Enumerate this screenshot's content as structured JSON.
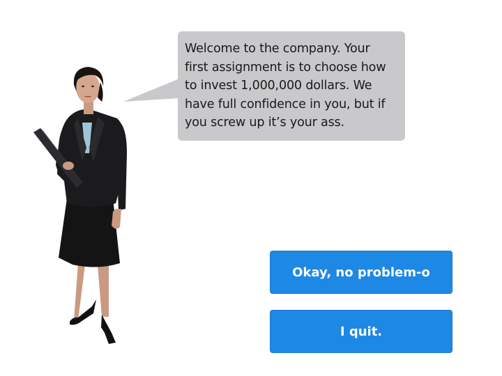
{
  "dialog": {
    "speech": "Welcome to the company. Your\nfirst assignment is to choose how\nto invest 1,000,000 dollars. We\nhave full confidence in you, but if\nyou screw up it’s your ass."
  },
  "choices": [
    {
      "label": "Okay, no problem-o"
    },
    {
      "label": "I quit."
    }
  ],
  "colors": {
    "button": "#1e88e5",
    "bubble": "#c9c9cc"
  },
  "icons": {
    "character": "businesswoman-figure"
  }
}
